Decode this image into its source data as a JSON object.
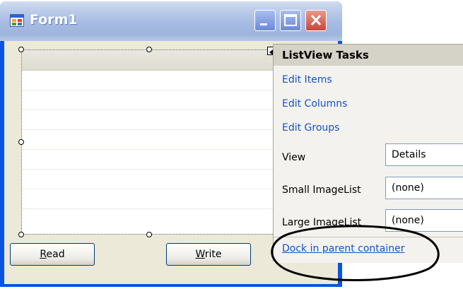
{
  "window": {
    "title": "Form1",
    "colors": {
      "title_text": "#ffffff",
      "close_button": "#c8453a",
      "link": "#1652c4"
    }
  },
  "form": {
    "buttons": [
      {
        "label": "Read",
        "mnemonic": "R"
      },
      {
        "label": "Write",
        "mnemonic": "W"
      }
    ]
  },
  "tasks_panel": {
    "title": "ListView Tasks",
    "links": [
      "Edit Items",
      "Edit Columns",
      "Edit Groups"
    ],
    "properties": [
      {
        "label": "View",
        "value": "Details"
      },
      {
        "label": "Small ImageList",
        "value": "(none)"
      },
      {
        "label": "Large ImageList",
        "value": "(none)"
      }
    ],
    "dock_link": "Dock in parent container"
  },
  "icons": [
    "form-app-icon",
    "minimize-icon",
    "maximize-icon",
    "close-icon",
    "smart-tag-arrow-icon"
  ]
}
